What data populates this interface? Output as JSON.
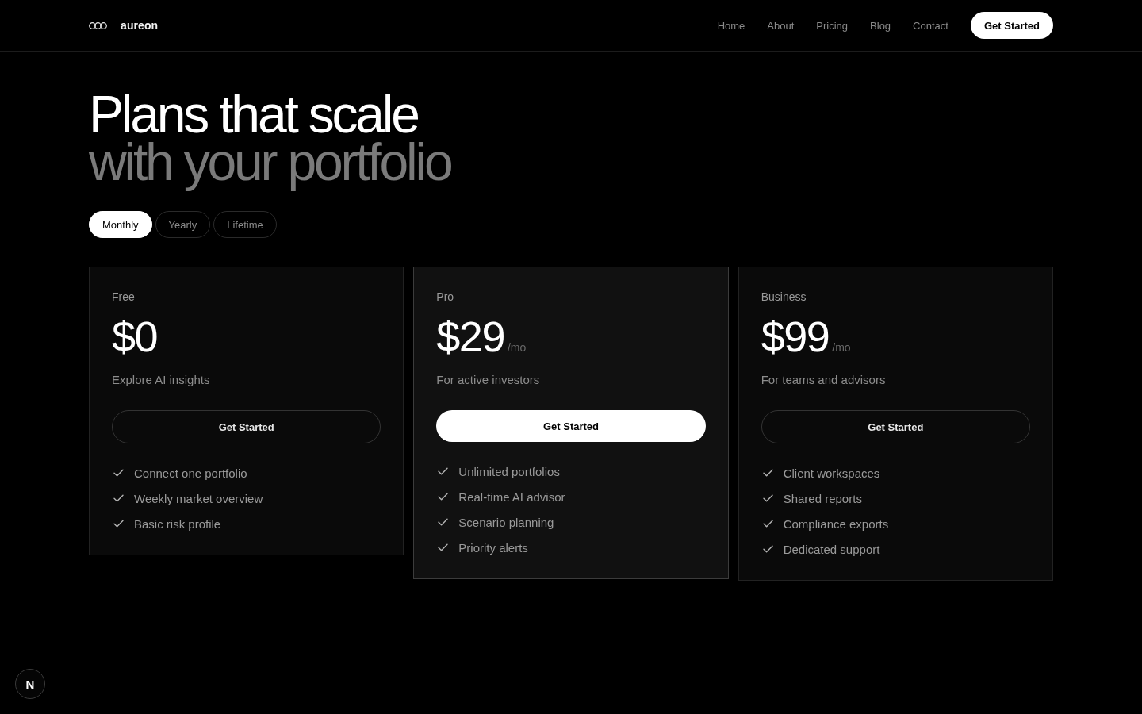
{
  "header": {
    "brand": "aureon",
    "nav": [
      "Home",
      "About",
      "Pricing",
      "Blog",
      "Contact"
    ],
    "cta": "Get Started"
  },
  "hero": {
    "title_line_1": "Plans that scale",
    "title_line_2": "with your portfolio"
  },
  "billing_tabs": [
    {
      "label": "Monthly",
      "selected": true
    },
    {
      "label": "Yearly",
      "selected": false
    },
    {
      "label": "Lifetime",
      "selected": false
    }
  ],
  "plans": [
    {
      "name": "Free",
      "price": "$0",
      "description": "Explore AI insights",
      "button": "Get Started",
      "featured": false,
      "features": [
        "Connect one portfolio",
        "Weekly market overview",
        "Basic risk profile"
      ]
    },
    {
      "name": "Pro",
      "price": "$29",
      "period": "/mo",
      "description": "For active investors",
      "button": "Get Started",
      "featured": true,
      "features": [
        "Unlimited portfolios",
        "Real-time AI advisor",
        "Scenario planning",
        "Priority alerts"
      ]
    },
    {
      "name": "Business",
      "price": "$99",
      "period": "/mo",
      "description": "For teams and advisors",
      "button": "Get Started",
      "featured": false,
      "features": [
        "Client workspaces",
        "Shared reports",
        "Compliance exports",
        "Dedicated support"
      ]
    }
  ],
  "dev_badge": {
    "label": "N"
  }
}
